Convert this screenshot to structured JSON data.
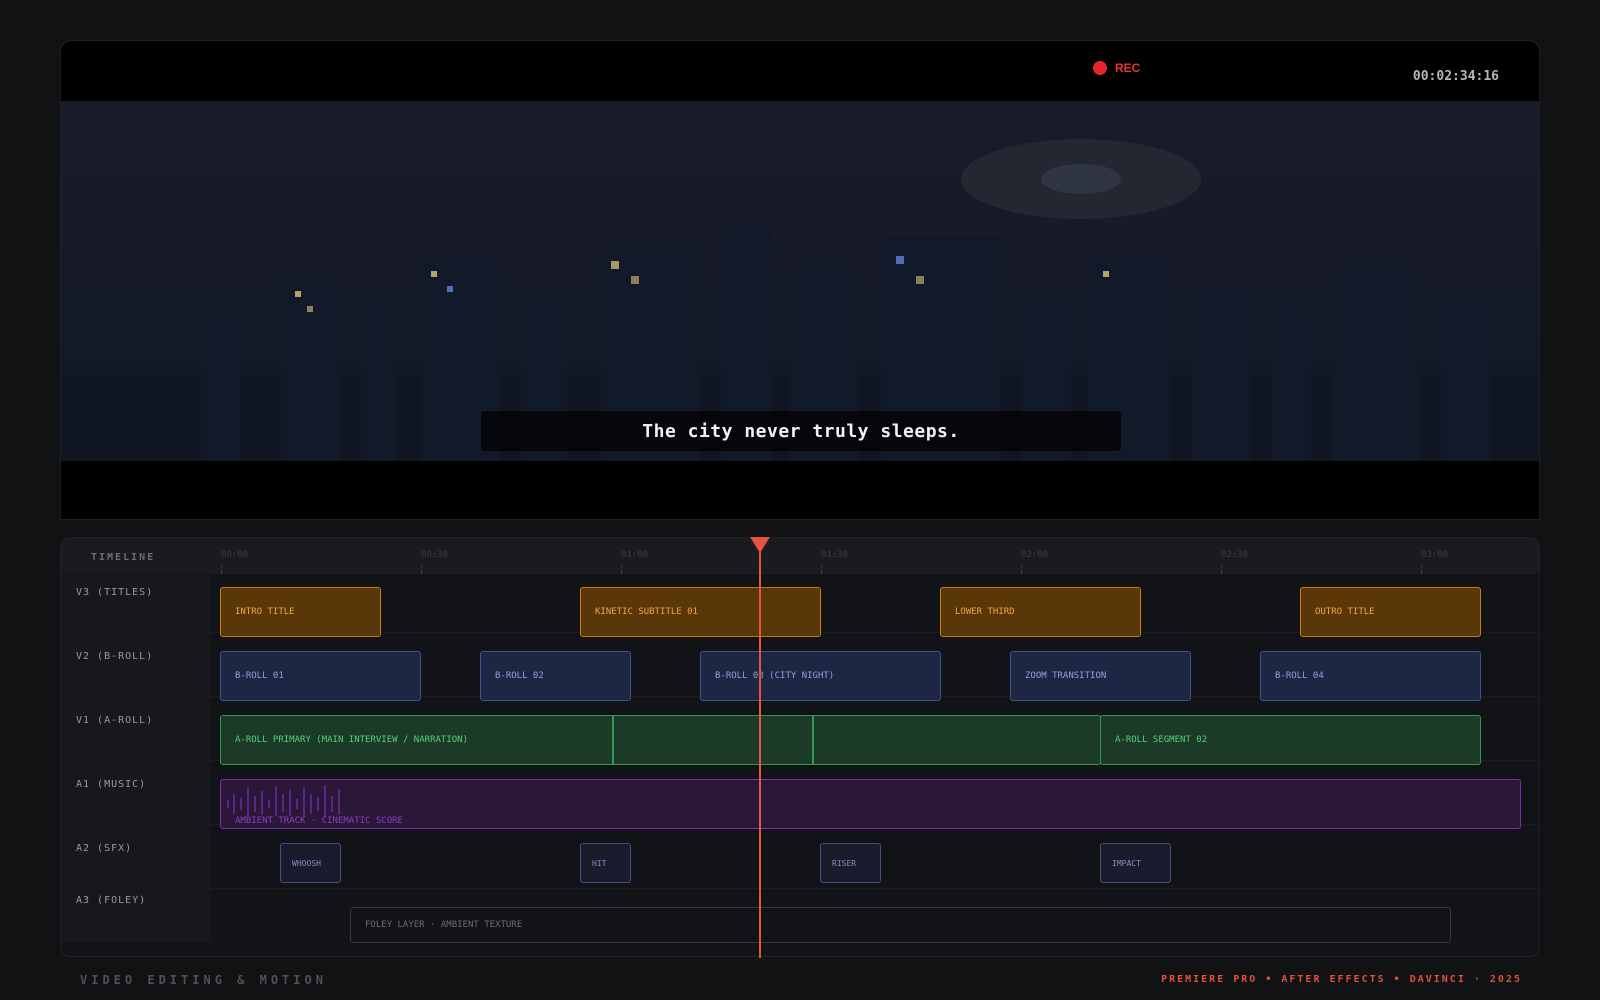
{
  "viewer": {
    "rec_label": "REC",
    "timecode": "00:02:34:16",
    "subtitle": "The city never truly sleeps."
  },
  "timeline": {
    "title": "TIMELINE",
    "ruler": [
      "00:00",
      "00:30",
      "01:00",
      "01:30",
      "02:00",
      "02:30",
      "03:00"
    ],
    "tracks": [
      {
        "label": "V3 (TITLES)"
      },
      {
        "label": "V2 (B-ROLL)"
      },
      {
        "label": "V1 (A-ROLL)"
      },
      {
        "label": "A1 (MUSIC)"
      },
      {
        "label": "A2 (SFX)"
      },
      {
        "label": "A3 (FOLEY)"
      }
    ],
    "clips": {
      "titles": [
        "INTRO TITLE",
        "KINETIC SUBTITLE 01",
        "LOWER THIRD",
        "OUTRO TITLE"
      ],
      "broll": [
        "B-ROLL 01",
        "B-ROLL 02",
        "B-ROLL 03 (CITY NIGHT)",
        "ZOOM TRANSITION",
        "B-ROLL 04"
      ],
      "aroll": [
        "A-ROLL PRIMARY (MAIN INTERVIEW / NARRATION)",
        "A-ROLL SEGMENT 02"
      ],
      "music": "AMBIENT TRACK · CINEMATIC SCORE",
      "sfx": [
        "WHOOSH",
        "HIT",
        "RISER",
        "IMPACT"
      ],
      "foley": "FOLEY LAYER · AMBIENT TEXTURE"
    }
  },
  "footer": {
    "left": "VIDEO EDITING & MOTION",
    "right": "PREMIERE PRO • AFTER EFFECTS • DAVINCI · 2025"
  },
  "colors": {
    "accent": "#e8533f",
    "rec": "#e8252a",
    "titles": "#c57a1e",
    "broll": "#3d528f",
    "aroll": "#2f9a52",
    "music": "#7b2fae",
    "sfx": "#4a4c86"
  }
}
